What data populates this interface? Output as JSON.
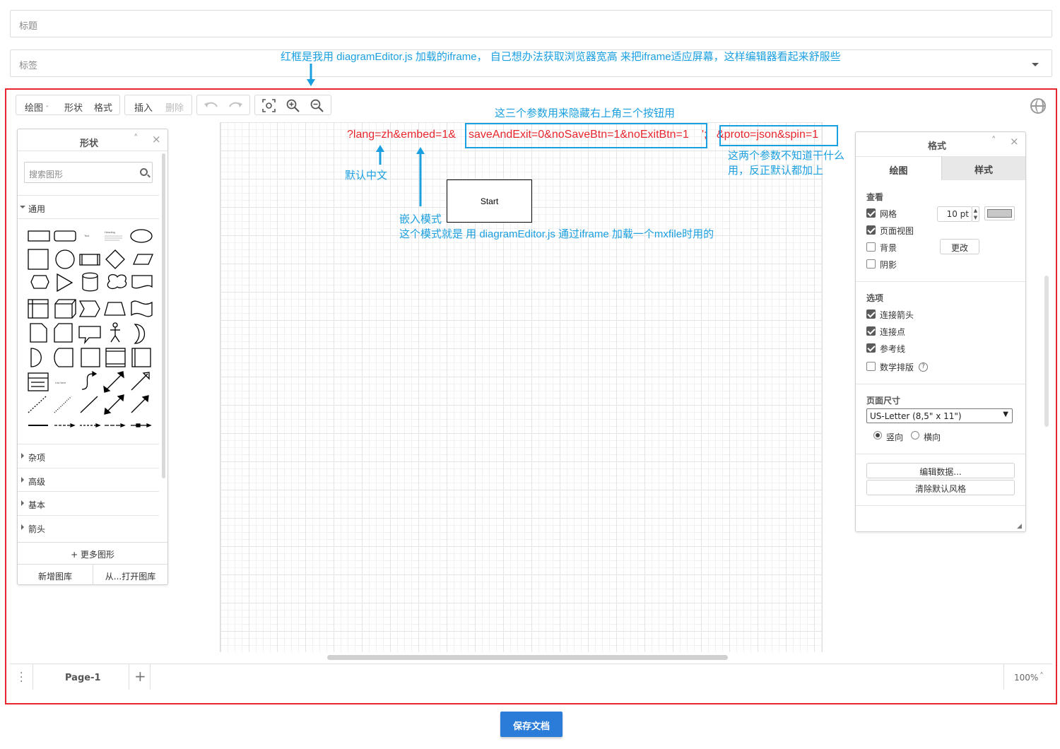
{
  "form": {
    "title_placeholder": "标题",
    "tags_placeholder": "标签",
    "save_button": "保存文档"
  },
  "annotations": {
    "top_note": "红框是我用 diagramEditor.js 加载的iframe， 自己想办法获取浏览器宽高 来把iframe适应屏幕，这样编辑器看起来舒服些",
    "three_params_note": "这三个参数用来隐藏右上角三个按钮用",
    "url_part1": "?lang=zh&embed=1&",
    "url_part2": "saveAndExit=0&noSaveBtn=1&noExitBtn=1",
    "url_part3": "';",
    "url_part4": "&proto=json&spin=1",
    "two_params_note_1": "这两个参数不知道干什么",
    "two_params_note_2": "用，反正默认都加上",
    "default_chinese": "默认中文",
    "embed_mode_1": "嵌入模式",
    "embed_mode_2": "这个模式就是 用 diagramEditor.js 通过iframe 加载一个mxfile时用的"
  },
  "toolbar": {
    "diagram": "绘图",
    "shape": "形状",
    "format": "格式",
    "insert": "插入",
    "delete": "删除"
  },
  "shapes_panel": {
    "title": "形状",
    "search_placeholder": "搜索图形",
    "sections": [
      "通用",
      "杂项",
      "高级",
      "基本",
      "箭头"
    ],
    "more_shapes": "+ 更多图形",
    "new_library": "新增图库",
    "open_library": "从...打开图库"
  },
  "canvas": {
    "start_label": "Start"
  },
  "format_panel": {
    "title": "格式",
    "tabs": [
      "绘图",
      "样式"
    ],
    "view_title": "查看",
    "grid": "网格",
    "grid_size": "10 pt",
    "page_view": "页面视图",
    "background": "背景",
    "change": "更改",
    "shadow": "阴影",
    "options_title": "选项",
    "connection_arrows": "连接箭头",
    "connection_points": "连接点",
    "guides": "参考线",
    "math": "数学排版",
    "page_size_title": "页面尺寸",
    "page_size_value": "US-Letter (8,5\" x 11\")",
    "portrait": "竖向",
    "landscape": "横向",
    "edit_data": "编辑数据...",
    "clear_default_style": "清除默认风格",
    "checked": {
      "grid": true,
      "page_view": true,
      "background": false,
      "shadow": false,
      "connection_arrows": true,
      "connection_points": true,
      "guides": true,
      "math": false
    },
    "orientation": "portrait",
    "grid_color": "#c8c8c8"
  },
  "footer": {
    "page_tab": "Page-1",
    "zoom": "100%"
  },
  "colors": {
    "annotation_blue": "#1a9fe0",
    "annotation_red": "#e8262d",
    "save_button_bg": "#2a7cd8"
  }
}
